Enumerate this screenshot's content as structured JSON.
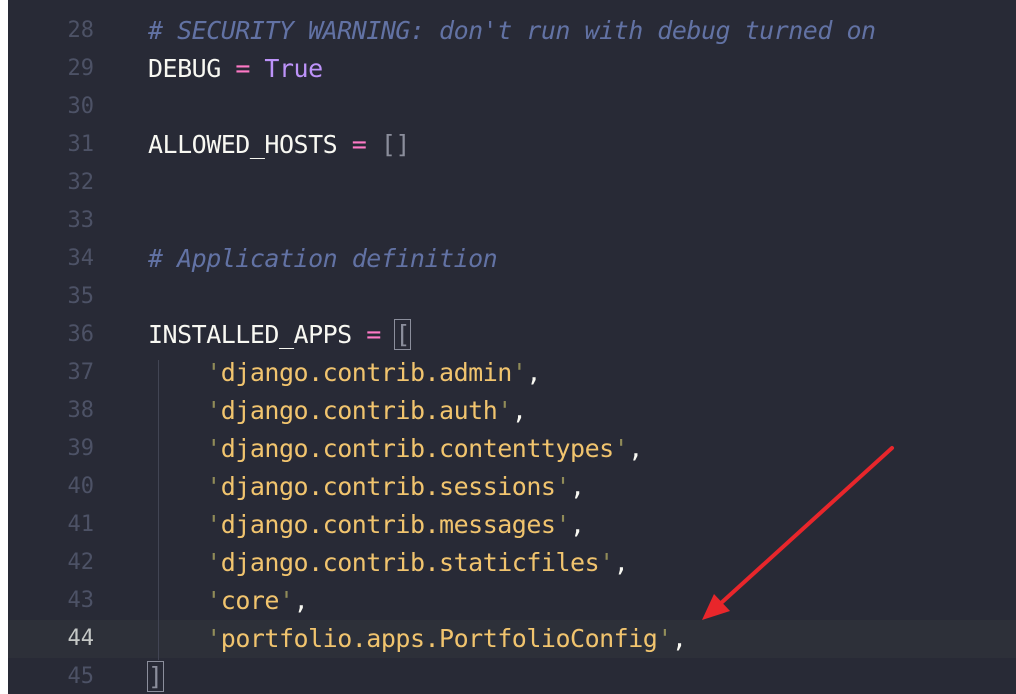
{
  "editor": {
    "lines": [
      {
        "num": "28",
        "tokens": [
          {
            "t": "# SECURITY WARNING: don't run with debug turned on",
            "c": "comment"
          }
        ]
      },
      {
        "num": "29",
        "tokens": [
          {
            "t": "DEBUG",
            "c": "ident"
          },
          {
            "t": " = ",
            "c": "op"
          },
          {
            "t": "True",
            "c": "bool"
          }
        ]
      },
      {
        "num": "30",
        "tokens": []
      },
      {
        "num": "31",
        "tokens": [
          {
            "t": "ALLOWED_HOSTS",
            "c": "ident"
          },
          {
            "t": " = ",
            "c": "op"
          },
          {
            "t": "[]",
            "c": "bracket"
          }
        ]
      },
      {
        "num": "32",
        "tokens": []
      },
      {
        "num": "33",
        "tokens": []
      },
      {
        "num": "34",
        "tokens": [
          {
            "t": "# Application definition",
            "c": "comment"
          }
        ]
      },
      {
        "num": "35",
        "tokens": []
      },
      {
        "num": "36",
        "tokens": [
          {
            "t": "INSTALLED_APPS",
            "c": "ident"
          },
          {
            "t": " = ",
            "c": "op"
          },
          {
            "t": "[",
            "c": "bracket-match"
          }
        ]
      },
      {
        "num": "37",
        "tokens": [
          {
            "t": "    ",
            "c": "ident"
          },
          {
            "t": "'",
            "c": "quote"
          },
          {
            "t": "django.contrib.admin",
            "c": "string"
          },
          {
            "t": "'",
            "c": "quote"
          },
          {
            "t": ",",
            "c": "comma"
          }
        ]
      },
      {
        "num": "38",
        "tokens": [
          {
            "t": "    ",
            "c": "ident"
          },
          {
            "t": "'",
            "c": "quote"
          },
          {
            "t": "django.contrib.auth",
            "c": "string"
          },
          {
            "t": "'",
            "c": "quote"
          },
          {
            "t": ",",
            "c": "comma"
          }
        ]
      },
      {
        "num": "39",
        "tokens": [
          {
            "t": "    ",
            "c": "ident"
          },
          {
            "t": "'",
            "c": "quote"
          },
          {
            "t": "django.contrib.contenttypes",
            "c": "string"
          },
          {
            "t": "'",
            "c": "quote"
          },
          {
            "t": ",",
            "c": "comma"
          }
        ]
      },
      {
        "num": "40",
        "tokens": [
          {
            "t": "    ",
            "c": "ident"
          },
          {
            "t": "'",
            "c": "quote"
          },
          {
            "t": "django.contrib.sessions",
            "c": "string"
          },
          {
            "t": "'",
            "c": "quote"
          },
          {
            "t": ",",
            "c": "comma"
          }
        ]
      },
      {
        "num": "41",
        "tokens": [
          {
            "t": "    ",
            "c": "ident"
          },
          {
            "t": "'",
            "c": "quote"
          },
          {
            "t": "django.contrib.messages",
            "c": "string"
          },
          {
            "t": "'",
            "c": "quote"
          },
          {
            "t": ",",
            "c": "comma"
          }
        ]
      },
      {
        "num": "42",
        "tokens": [
          {
            "t": "    ",
            "c": "ident"
          },
          {
            "t": "'",
            "c": "quote"
          },
          {
            "t": "django.contrib.staticfiles",
            "c": "string"
          },
          {
            "t": "'",
            "c": "quote"
          },
          {
            "t": ",",
            "c": "comma"
          }
        ]
      },
      {
        "num": "43",
        "tokens": [
          {
            "t": "    ",
            "c": "ident"
          },
          {
            "t": "'",
            "c": "quote"
          },
          {
            "t": "core",
            "c": "string"
          },
          {
            "t": "'",
            "c": "quote"
          },
          {
            "t": ",",
            "c": "comma"
          }
        ]
      },
      {
        "num": "44",
        "current": true,
        "tokens": [
          {
            "t": "    ",
            "c": "ident"
          },
          {
            "t": "'",
            "c": "quote"
          },
          {
            "t": "portfolio.apps.PortfolioConfig",
            "c": "string"
          },
          {
            "t": "'",
            "c": "quote"
          },
          {
            "t": ",",
            "c": "comma"
          }
        ]
      },
      {
        "num": "45",
        "tokens": [
          {
            "t": "]",
            "c": "bracket-match"
          }
        ]
      }
    ]
  },
  "colors": {
    "background": "#282a36",
    "annotation_arrow": "#e8262b"
  }
}
